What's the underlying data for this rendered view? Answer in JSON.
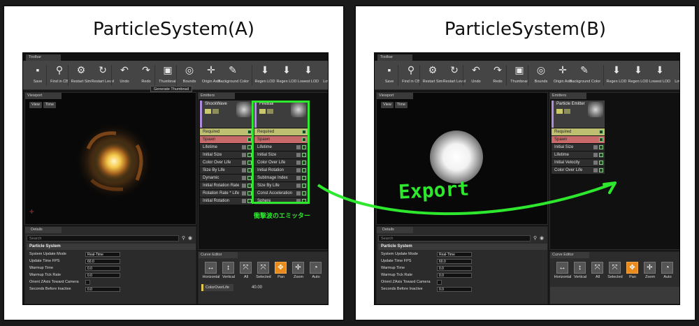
{
  "panels": [
    {
      "title": "ParticleSystem(A)",
      "tab": "Toolbar",
      "toolbar": [
        {
          "label": "Save",
          "icon": "save-icon",
          "glyph": "▪"
        },
        {
          "label": "Find in CB",
          "icon": "magnifier-icon",
          "glyph": "⚲"
        },
        {
          "label": "Restart Sim",
          "icon": "gear-restart-icon",
          "glyph": "⚙"
        },
        {
          "label": "Restart Level",
          "icon": "restart-icon",
          "glyph": "↻"
        },
        {
          "label": "Undo",
          "icon": "undo-icon",
          "glyph": "↶"
        },
        {
          "label": "Redo",
          "icon": "redo-icon",
          "glyph": "↷"
        },
        {
          "label": "Thumbnail",
          "icon": "thumbnail-icon",
          "glyph": "▣"
        },
        {
          "label": "Bounds",
          "icon": "bounds-icon",
          "glyph": "◎"
        },
        {
          "label": "Origin Axis",
          "icon": "axis-icon",
          "glyph": "✛"
        },
        {
          "label": "Background Color",
          "icon": "brush-icon",
          "glyph": "✎"
        },
        {
          "label": "Regen LOD",
          "icon": "lod-icon",
          "glyph": "⬇"
        },
        {
          "label": "Regen LOD",
          "icon": "lod-icon",
          "glyph": "⬇"
        },
        {
          "label": "Lowest LOD",
          "icon": "lowest-lod-icon",
          "glyph": "⬇"
        },
        {
          "label": "Lower L",
          "icon": "lower-lod-icon",
          "glyph": "⬇"
        }
      ],
      "tooltip": "Generate Thumbnail",
      "viewport_tab": "Viewport",
      "view_buttons": [
        "View",
        "Time"
      ],
      "emitters_tab": "Emitters",
      "emitters": [
        {
          "name": "ShockWave",
          "modules": [
            "Required",
            "Spawn",
            "Lifetime",
            "Initial Size",
            "Color Over Life",
            "Size By Life",
            "Dynamic",
            "Initial Rotation Rate",
            "Rotation Rate * Life",
            "Initial Rotation"
          ]
        },
        {
          "name": "FireBall",
          "modules": [
            "Required",
            "Spawn",
            "Lifetime",
            "Initial Size",
            "Color Over Life",
            "Initial Rotation",
            "SubImage Index",
            "Size By Life",
            "Const Acceleration",
            "Sphere"
          ]
        }
      ],
      "highlight_label": "衝撃波のエミッター",
      "details": {
        "tab": "Details",
        "search": "Search",
        "section": "Particle System",
        "rows": [
          {
            "label": "System Update Mode",
            "value": "Real-Time"
          },
          {
            "label": "Update Time FPS",
            "value": "60.0"
          },
          {
            "label": "Warmup Time",
            "value": "0.0"
          },
          {
            "label": "Warmup Tick Rate",
            "value": "0.0"
          },
          {
            "label": "Orient ZAxis Toward Camera",
            "value": ""
          },
          {
            "label": "Seconds Before Inactive",
            "value": "0.0"
          }
        ]
      },
      "curve": {
        "tab": "Curve Editor",
        "buttons": [
          {
            "label": "Horizontal",
            "glyph": "↔"
          },
          {
            "label": "Vertical",
            "glyph": "↕"
          },
          {
            "label": "All",
            "glyph": "⤧"
          },
          {
            "label": "Selected",
            "glyph": "⤧"
          },
          {
            "label": "Pan",
            "glyph": "✥"
          },
          {
            "label": "Zoom",
            "glyph": "✢"
          },
          {
            "label": "Auto",
            "glyph": "◔"
          }
        ],
        "track": "ColorOverLife",
        "value": "40.00"
      }
    },
    {
      "title": "ParticleSystem(B)",
      "tab": "Toolbar",
      "viewport_tab": "Viewport",
      "view_buttons": [
        "View",
        "Time"
      ],
      "emitters_tab": "Emitters",
      "emitters": [
        {
          "name": "Particle Emitter",
          "modules": [
            "Required",
            "Spawn",
            "Initial Size",
            "Lifetime",
            "Initial Velocity",
            "Color Over Life"
          ]
        }
      ]
    }
  ],
  "annotation": {
    "export_label": "Export",
    "arrow_color": "#2ee82e"
  }
}
